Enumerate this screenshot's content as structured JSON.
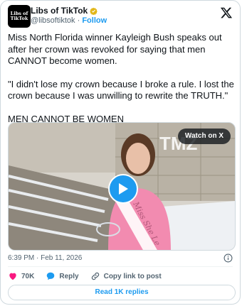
{
  "author": {
    "name": "Libs of TikTok",
    "handle": "@libsoftiktok",
    "separator": "·",
    "follow_label": "Follow",
    "avatar_text": "Libs of TikTok"
  },
  "tweet": {
    "paragraphs": [
      "Miss North Florida winner Kayleigh Bush speaks out after her crown was revoked for saying that men CANNOT become women.",
      "\"I didn't lose my crown because I broke a rule. I lost the crown because I was unwilling to rewrite the TRUTH.\"",
      "MEN CANNOT BE WOMEN"
    ]
  },
  "media": {
    "watch_label": "Watch on X",
    "watermark": "TMZ",
    "sash_text": "Miss She Le"
  },
  "meta": {
    "timestamp": "6:39 PM · Feb 11, 2026"
  },
  "actions": {
    "like_count": "70K",
    "reply_label": "Reply",
    "copy_label": "Copy link to post"
  },
  "read_replies_label": "Read 1K replies",
  "colors": {
    "accent": "#1d9bf0",
    "like": "#f91880",
    "text": "#0f1419",
    "muted": "#536471"
  }
}
